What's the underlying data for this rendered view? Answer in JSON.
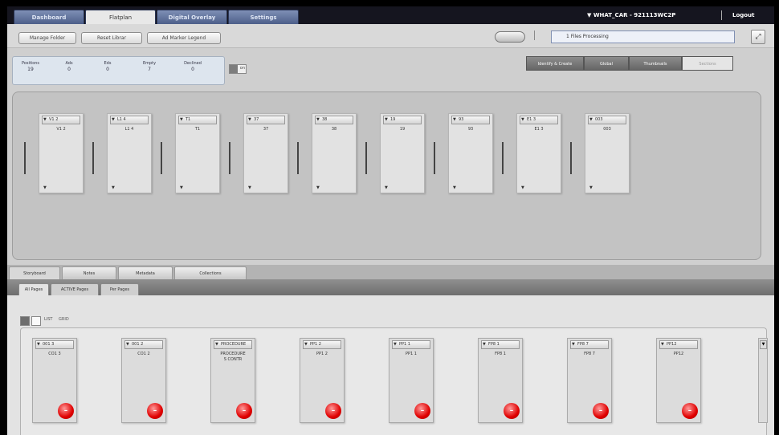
{
  "nav": {
    "tabs": [
      {
        "label": "Dashboard"
      },
      {
        "label": "Flatplan"
      },
      {
        "label": "Digital Overlay"
      },
      {
        "label": "Settings"
      }
    ],
    "account": "WHAT_CAR - 921113WC2P",
    "logout": "Logout"
  },
  "toolbar": {
    "manage_folder": "Manage Folder",
    "reset_librar": "Reset Librar",
    "ad_marker_legend": "Ad Marker Legend",
    "status": "1 Files Processing"
  },
  "stats": [
    {
      "label": "Positions",
      "value": "19"
    },
    {
      "label": "Ads",
      "value": "0"
    },
    {
      "label": "Eds",
      "value": "0"
    },
    {
      "label": "Empty",
      "value": "7"
    },
    {
      "label": "Declined",
      "value": "0"
    }
  ],
  "views": [
    {
      "label": "Identify & Create",
      "active": false
    },
    {
      "label": "Global",
      "active": false
    },
    {
      "label": "Thumbnails",
      "active": false
    },
    {
      "label": "Sections",
      "active": true
    }
  ],
  "storyboard_cards": [
    {
      "header": "V1 2",
      "title": "V1 2"
    },
    {
      "header": "L1 4",
      "title": "L1 4"
    },
    {
      "header": "T1",
      "title": "T1"
    },
    {
      "header": "37",
      "title": "37"
    },
    {
      "header": "38",
      "title": "38"
    },
    {
      "header": "19",
      "title": "19"
    },
    {
      "header": "93",
      "title": "93"
    },
    {
      "header": "E1 3",
      "title": "E1 3"
    },
    {
      "header": "003",
      "title": "003"
    }
  ],
  "lower_tabs": [
    "Storyboard",
    "Notes",
    "Metadata",
    "Collections"
  ],
  "sub_tabs": [
    "All Pages",
    "ACTIVE Pages",
    "Per Pages"
  ],
  "controls": {
    "link_a": "LIST",
    "link_b": "GRID"
  },
  "library_cards": [
    {
      "header": "001 3",
      "title": "CO1 3"
    },
    {
      "header": "001 2",
      "title": "CO1 2"
    },
    {
      "header": "PROCEDURE",
      "title": "PROCEDURE\nS CONTR"
    },
    {
      "header": "PP1 2",
      "title": "PP1 2"
    },
    {
      "header": "PP1 1",
      "title": "PP1 1"
    },
    {
      "header": "FP8 1",
      "title": "FP8 1"
    },
    {
      "header": "FP8 7",
      "title": "FP8 7"
    },
    {
      "header": "PP12",
      "title": "PP12"
    }
  ],
  "colors": {
    "nav_bg": "#15151f",
    "delete": "#e00000",
    "tab_blue": "#5b6c96"
  }
}
